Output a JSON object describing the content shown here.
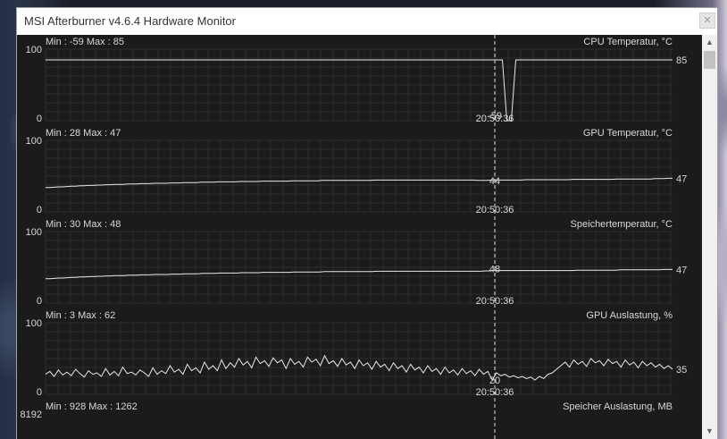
{
  "window": {
    "title": "MSI Afterburner v4.6.4 Hardware Monitor",
    "close_glyph": "✕"
  },
  "scrollbar": {
    "up_glyph": "▲",
    "down_glyph": "▼"
  },
  "chart_data": [
    {
      "type": "line",
      "title": "CPU Temperatur, °C",
      "min_max": "Min : -59   Max : 85",
      "ylim": [
        0,
        100
      ],
      "y_top_label": "100",
      "y_bottom_label": "0",
      "current_value": "85",
      "cursor_value": "-59",
      "cursor_time": "20:50:36",
      "values": [
        85,
        85,
        85,
        85,
        85,
        85,
        85,
        85,
        85,
        85,
        85,
        85,
        85,
        85,
        85,
        85,
        85,
        85,
        85,
        85,
        85,
        85,
        85,
        85,
        85,
        85,
        85,
        85,
        85,
        85,
        85,
        85,
        85,
        85,
        85,
        85,
        85,
        85,
        85,
        85,
        85,
        85,
        85,
        85,
        85,
        85,
        85,
        85,
        85,
        85,
        85,
        85,
        85,
        85,
        85,
        85,
        85,
        85,
        85,
        85,
        85,
        85,
        85,
        85,
        85,
        85,
        85,
        85,
        85,
        85,
        85,
        85,
        85,
        85,
        85,
        85,
        85,
        85,
        85,
        85,
        85,
        85,
        85,
        85,
        85,
        85,
        85,
        85,
        85,
        85,
        85,
        85,
        85,
        85,
        85,
        85,
        85,
        85,
        85,
        85,
        85,
        85,
        85,
        -59,
        -59,
        85,
        85,
        85,
        85,
        85,
        85,
        85,
        85,
        85,
        85,
        85,
        85,
        85,
        85,
        85,
        85,
        85,
        85,
        85,
        85,
        85,
        85,
        85,
        85,
        85,
        85,
        85,
        85,
        85,
        85,
        85,
        85,
        85,
        85,
        85,
        85
      ]
    },
    {
      "type": "line",
      "title": "GPU Temperatur, °C",
      "min_max": "Min : 28   Max : 47",
      "ylim": [
        0,
        100
      ],
      "y_top_label": "100",
      "y_bottom_label": "0",
      "current_value": "47",
      "cursor_value": "44",
      "cursor_time": "20:50:36",
      "values": [
        34,
        34,
        34.5,
        35,
        35,
        35.5,
        36,
        36,
        36.5,
        36.5,
        37,
        37,
        37.5,
        37.5,
        38,
        38,
        38.5,
        38.5,
        38.5,
        39,
        39,
        39,
        39.5,
        39.5,
        39.5,
        40,
        40,
        40,
        40,
        40.5,
        40.5,
        40.5,
        41,
        41,
        41,
        41,
        41.5,
        41.5,
        41.5,
        41.5,
        42,
        42,
        42,
        42,
        42,
        42.5,
        42.5,
        42.5,
        42.5,
        42.5,
        43,
        43,
        43,
        43,
        43,
        43,
        43,
        43.5,
        43.5,
        43.5,
        43.5,
        43.5,
        43.5,
        43.5,
        44,
        44,
        44,
        44,
        44,
        44,
        44,
        44,
        44,
        44,
        44,
        44,
        44.5,
        44.5,
        44.5,
        44.5,
        44.5,
        44.5,
        44.5,
        44.5,
        44.5,
        44.5,
        44.5,
        44.5,
        44.5,
        44.5,
        44.5,
        44.5,
        44.5,
        44.5,
        44.5,
        44.5,
        44.5,
        44.5,
        44.5,
        44.5,
        44,
        44,
        44,
        44.5,
        44.5,
        44.5,
        44.5,
        44.5,
        44.5,
        44.5,
        44.5,
        45,
        45,
        45,
        45,
        45,
        45,
        45,
        45,
        45,
        45,
        45,
        45.5,
        45.5,
        45.5,
        45.5,
        45.5,
        45.5,
        45.5,
        45.5,
        45.5,
        45.5,
        46,
        46,
        46,
        46,
        46,
        46,
        46,
        46,
        46,
        46.5,
        46.5,
        46.5,
        47,
        47
      ]
    },
    {
      "type": "line",
      "title": "Speichertemperatur, °C",
      "min_max": "Min : 30   Max : 48",
      "ylim": [
        0,
        100
      ],
      "y_top_label": "100",
      "y_bottom_label": "0",
      "current_value": "47",
      "cursor_value": "48",
      "cursor_time": "20:50:36",
      "values": [
        34,
        34,
        34.5,
        35,
        35,
        35.5,
        36,
        36,
        36.5,
        36.5,
        37,
        37,
        37.5,
        37.5,
        38,
        38,
        38.5,
        38.5,
        38.5,
        39,
        39,
        39,
        39.5,
        39.5,
        39.5,
        40,
        40,
        40,
        40,
        40.5,
        40.5,
        40.5,
        41,
        41,
        41,
        41,
        41.5,
        41.5,
        41.5,
        41.5,
        42,
        42,
        42,
        42,
        42,
        42.5,
        42.5,
        42.5,
        42.5,
        42.5,
        43,
        43,
        43,
        43,
        43,
        43,
        43,
        43.5,
        43.5,
        43.5,
        43.5,
        43.5,
        43.5,
        43.5,
        44,
        44,
        44,
        44,
        44,
        44,
        44,
        44,
        44,
        44,
        44,
        44,
        44.5,
        44.5,
        44.5,
        44.5,
        44.5,
        44.5,
        44.5,
        44.5,
        44.5,
        44.5,
        44.5,
        44.5,
        44.5,
        44.5,
        44.5,
        44.5,
        44.5,
        44.5,
        44.5,
        44.5,
        44.5,
        44.5,
        44.5,
        44.5,
        44.5,
        45,
        45,
        45.5,
        45.5,
        45.5,
        45.5,
        45.5,
        45.5,
        45.5,
        45.5,
        45.5,
        45.5,
        45.5,
        45.5,
        45.5,
        45.5,
        45.5,
        45.5,
        45.5,
        45.5,
        45.5,
        46,
        46,
        46,
        46,
        46,
        46,
        46,
        46,
        46,
        46,
        46.5,
        46.5,
        46.5,
        46.5,
        46.5,
        46.5,
        46.5,
        46.5,
        46.5,
        46.5,
        47,
        47,
        47
      ]
    },
    {
      "type": "line",
      "title": "GPU Auslastung, %",
      "min_max": "Min : 3   Max : 62",
      "ylim": [
        0,
        100
      ],
      "y_top_label": "100",
      "y_bottom_label": "0",
      "current_value": "35",
      "cursor_value": "20",
      "cursor_time": "20:50:36",
      "values": [
        28,
        32,
        25,
        34,
        27,
        31,
        26,
        35,
        29,
        24,
        33,
        28,
        30,
        25,
        36,
        27,
        32,
        26,
        38,
        29,
        31,
        27,
        34,
        30,
        25,
        37,
        28,
        33,
        29,
        40,
        31,
        35,
        28,
        42,
        33,
        37,
        30,
        45,
        35,
        40,
        33,
        48,
        36,
        44,
        38,
        50,
        41,
        46,
        37,
        52,
        43,
        47,
        39,
        51,
        44,
        48,
        36,
        50,
        42,
        46,
        38,
        52,
        45,
        49,
        40,
        54,
        43,
        47,
        39,
        50,
        41,
        45,
        36,
        48,
        40,
        44,
        35,
        46,
        38,
        42,
        33,
        44,
        36,
        40,
        31,
        42,
        34,
        38,
        30,
        40,
        32,
        36,
        28,
        38,
        30,
        34,
        27,
        36,
        29,
        33,
        26,
        35,
        28,
        32,
        20,
        30,
        26,
        28,
        24,
        26,
        23,
        25,
        22,
        24,
        20,
        25,
        22,
        28,
        30,
        35,
        40,
        45,
        38,
        48,
        42,
        46,
        39,
        50,
        44,
        47,
        40,
        49,
        43,
        46,
        38,
        48,
        41,
        45,
        37,
        46,
        40,
        44,
        38,
        42,
        36,
        40,
        35
      ]
    },
    {
      "type": "line",
      "title": "Speicher Auslastung, MB",
      "min_max": "Min : 928   Max : 1262",
      "y_top_label": "8192"
    }
  ]
}
